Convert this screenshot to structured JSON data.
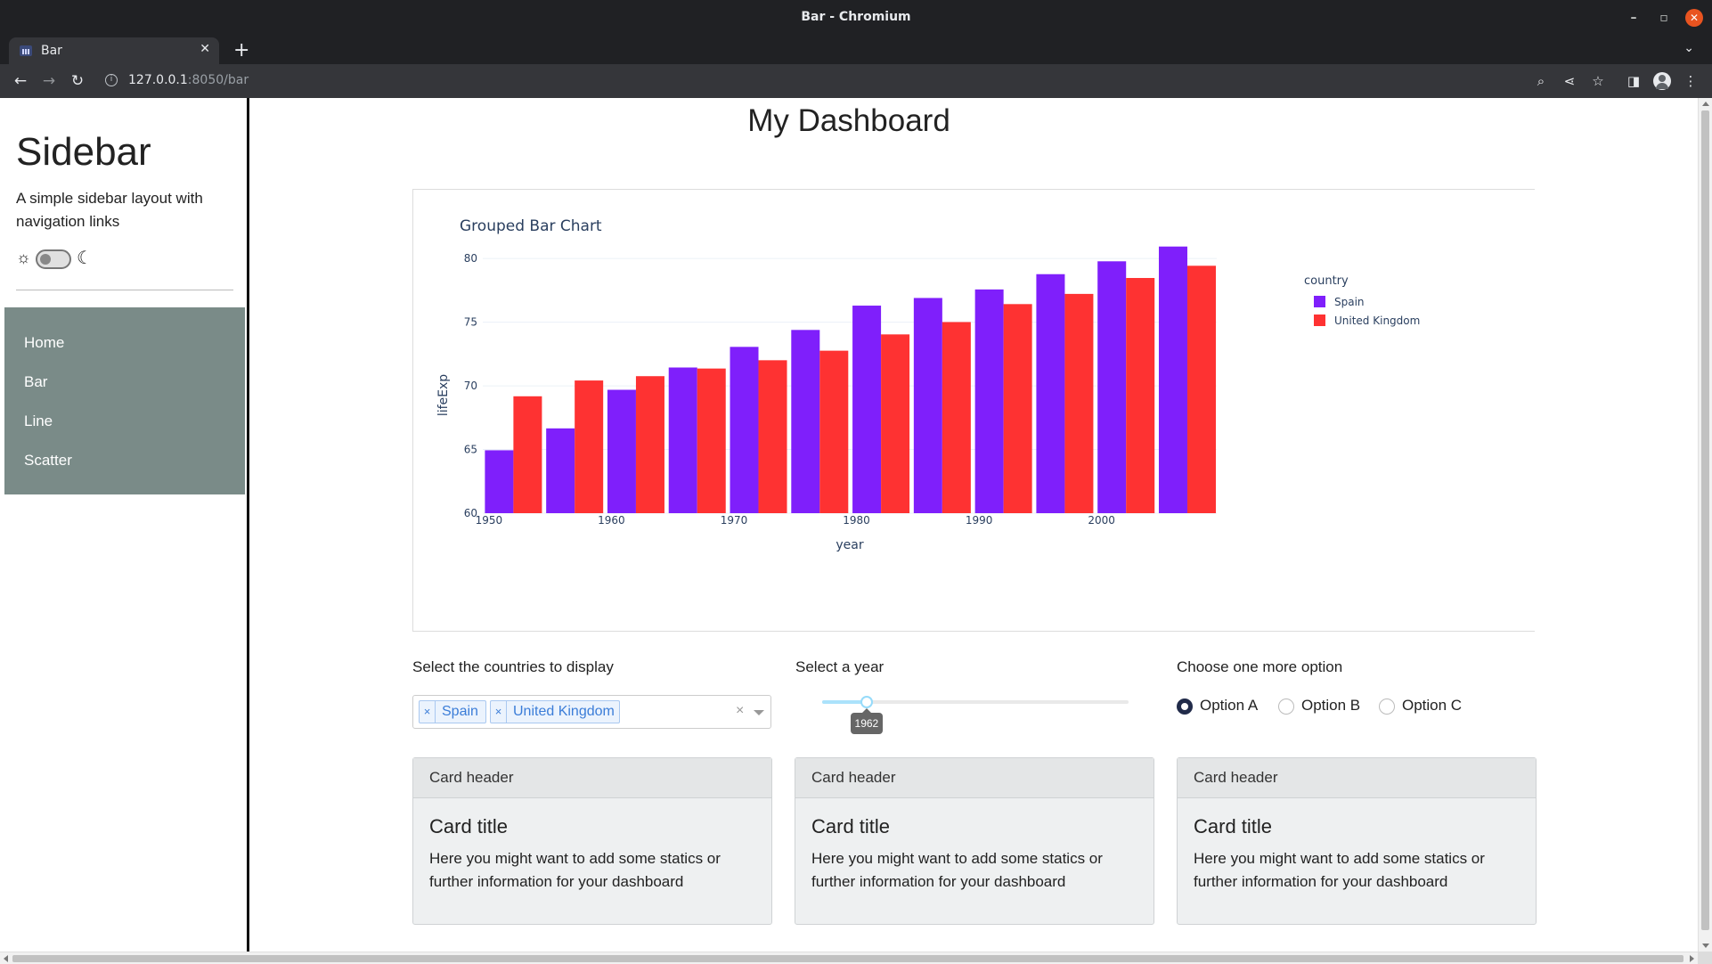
{
  "window": {
    "title": "Bar - Chromium"
  },
  "tab": {
    "label": "Bar"
  },
  "address": {
    "host": "127.0.0.1",
    "path": ":8050/bar"
  },
  "sidebar": {
    "title": "Sidebar",
    "subtitle": "A simple sidebar layout with navigation links",
    "nav": [
      {
        "label": "Home"
      },
      {
        "label": "Bar"
      },
      {
        "label": "Line"
      },
      {
        "label": "Scatter"
      }
    ],
    "nav_bg": "#7a8b88"
  },
  "page": {
    "title": "My Dashboard"
  },
  "chart_data": {
    "type": "bar",
    "title": "Grouped Bar Chart",
    "xlabel": "year",
    "ylabel": "lifeExp",
    "x": [
      1952,
      1957,
      1962,
      1967,
      1972,
      1977,
      1982,
      1987,
      1992,
      1997,
      2002,
      2007
    ],
    "x_ticks": [
      "1950",
      "1960",
      "1970",
      "1980",
      "1990",
      "2000"
    ],
    "y_ticks": [
      "60",
      "65",
      "70",
      "75",
      "80"
    ],
    "ylim": [
      60,
      80.5
    ],
    "legend_title": "country",
    "legend_position": "top-right",
    "grid": true,
    "series": [
      {
        "name": "Spain",
        "color": "#7f1ffb",
        "values": [
          64.94,
          66.66,
          69.69,
          71.44,
          73.06,
          74.39,
          76.3,
          76.9,
          77.57,
          78.77,
          79.78,
          80.94
        ]
      },
      {
        "name": "United Kingdom",
        "color": "#fe3232",
        "values": [
          69.18,
          70.42,
          70.76,
          71.36,
          72.01,
          72.76,
          74.04,
          75.01,
          76.42,
          77.22,
          78.47,
          79.43
        ]
      }
    ]
  },
  "controls": {
    "countries_label": "Select the countries to display",
    "countries_selected": [
      "Spain",
      "United Kingdom"
    ],
    "chip_remove": "×",
    "clear_glyph": "×",
    "year_label": "Select a year",
    "year_value": "1962",
    "year_position_fraction": 0.145,
    "option_label": "Choose one more option",
    "options": [
      {
        "label": "Option A",
        "checked": true
      },
      {
        "label": "Option B",
        "checked": false
      },
      {
        "label": "Option C",
        "checked": false
      }
    ]
  },
  "cards": [
    {
      "header": "Card header",
      "title": "Card title",
      "text": "Here you might want to add some statics or further information for your dashboard"
    },
    {
      "header": "Card header",
      "title": "Card title",
      "text": "Here you might want to add some statics or further information for your dashboard"
    },
    {
      "header": "Card header",
      "title": "Card title",
      "text": "Here you might want to add some statics or further information for your dashboard"
    }
  ]
}
